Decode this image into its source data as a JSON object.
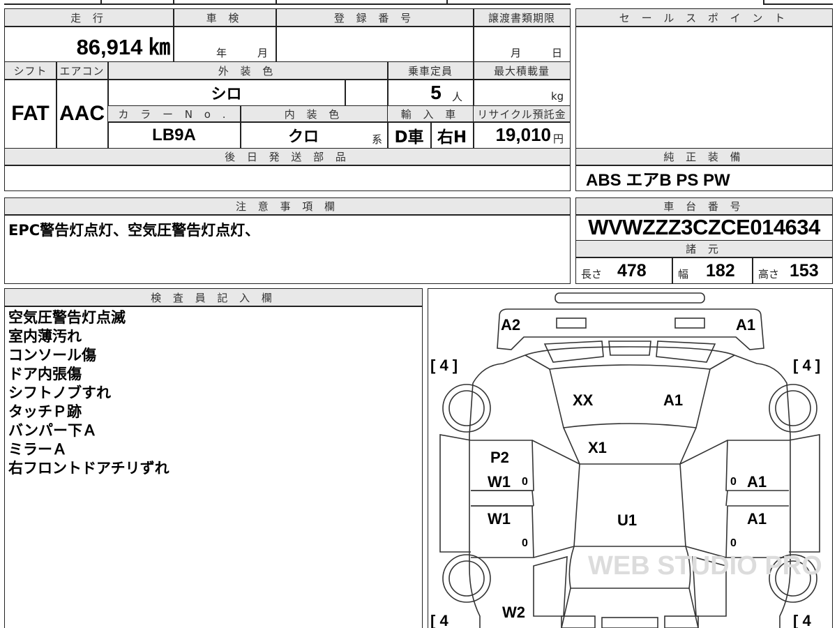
{
  "headers": {
    "mileage": "走 行",
    "inspection": "車 検",
    "registration": "登 録 番 号",
    "transfer_deadline": "譲渡書類期限",
    "sales_point": "セ ー ル ス ポ イ ン ト",
    "shift": "シフト",
    "aircon": "エアコン",
    "exterior_color": "外 装 色",
    "capacity": "乗車定員",
    "max_load": "最大積載量",
    "color_no": "カ ラ ー N o .",
    "interior_color": "内 装 色",
    "import": "輸 入 車",
    "recycle": "リサイクル預託金",
    "deferred_parts": "後 日 発 送 部 品",
    "genuine_equipment": "純 正 装 備",
    "notes": "注 意 事 項 欄",
    "chassis_no": "車 台 番 号",
    "specs": "諸 元",
    "inspector": "検 査 員 記 入 欄"
  },
  "values": {
    "mileage": "86,914 ㎞",
    "inspection_year": "年",
    "inspection_month": "月",
    "deadline_month": "月",
    "deadline_day": "日",
    "shift": "FAT",
    "aircon": "AAC",
    "exterior_color": "シロ",
    "capacity": "5",
    "capacity_unit": "人",
    "max_load_unit": "kg",
    "color_no": "LB9A",
    "interior_color": "クロ",
    "interior_suffix": "系",
    "import_type": "D車",
    "handle": "右H",
    "recycle_fee": "19,010",
    "recycle_unit": "円",
    "genuine_equipment": "ABS エアB PS PW",
    "chassis_no": "WVWZZZ3CZCE014634",
    "length_label": "長さ",
    "length": "478",
    "width_label": "幅",
    "width": "182",
    "height_label": "高さ",
    "height": "153"
  },
  "notes_text": "EPC警告灯点灯、空気圧警告灯点灯、",
  "inspector_notes": [
    "空気圧警告灯点滅",
    "室内薄汚れ",
    "コンソール傷",
    "ドア内張傷",
    "シフトノブすれ",
    "タッチＰ跡",
    "バンパー下Ａ",
    "ミラーＡ",
    "右フロントドアチリずれ"
  ],
  "diagram": {
    "marks": [
      "A2",
      "A1",
      "XX",
      "A1",
      "X1",
      "P2",
      "W1",
      "A1",
      "W1",
      "U1",
      "A1",
      "W2"
    ],
    "tire_left_top": "[ 4 ]",
    "tire_right_top": "[ 4 ]",
    "tire_left_bottom": "[ 4",
    "tire_right_bottom": "[ 4",
    "zero": "0",
    "watermark": "WEB STUDIO PRO"
  }
}
